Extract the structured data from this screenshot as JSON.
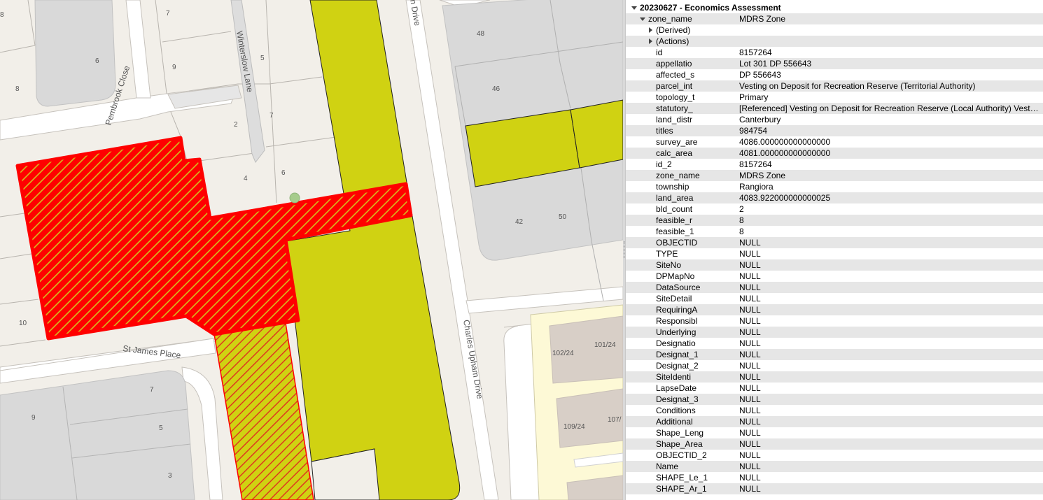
{
  "map": {
    "streets": {
      "pembrook": "Pembrook Close",
      "winterslow": "Winterslow Lane",
      "st_james": "St James Place",
      "charles_upham": "Charles Upham Drive",
      "charles_upham_top": "n Drive"
    },
    "lot_numbers": {
      "n8_top": "8",
      "n7": "7",
      "n5": "5",
      "n9_up": "9",
      "n6_top": "6",
      "n8": "8",
      "n2": "2",
      "n4": "4",
      "n6": "6",
      "n7_lane": "7",
      "n10": "10",
      "n48": "48",
      "n46": "46",
      "n42": "42",
      "n50": "50",
      "n7_low": "7",
      "n9_low": "9",
      "n5_low": "5",
      "n3": "3",
      "b102": "102/24",
      "b101": "101/24",
      "b109": "109/24",
      "b107": "107/"
    },
    "colors": {
      "highlight": "#ff0000",
      "zone": "#d0d212",
      "background": "#f2efe9",
      "parcel": "#d9d9d9"
    }
  },
  "panel": {
    "layer_title": "20230627 - Economics Assessment",
    "feature": {
      "key": "zone_name",
      "value": "MDRS Zone"
    },
    "groups": [
      "(Derived)",
      "(Actions)"
    ],
    "attributes": [
      {
        "key": "id",
        "value": "8157264"
      },
      {
        "key": "appellatio",
        "value": "Lot 301 DP 556643"
      },
      {
        "key": "affected_s",
        "value": "DP 556643"
      },
      {
        "key": "parcel_int",
        "value": "Vesting on Deposit for Recreation Reserve (Territorial Authority)"
      },
      {
        "key": "topology_t",
        "value": "Primary"
      },
      {
        "key": "statutory_",
        "value": "[Referenced] Vesting on Deposit for Recreation Reserve (Local Authority) Vested..."
      },
      {
        "key": "land_distr",
        "value": "Canterbury"
      },
      {
        "key": "titles",
        "value": "984754"
      },
      {
        "key": "survey_are",
        "value": "4086.000000000000000"
      },
      {
        "key": "calc_area",
        "value": "4081.000000000000000"
      },
      {
        "key": "id_2",
        "value": "8157264"
      },
      {
        "key": "zone_name",
        "value": "MDRS Zone"
      },
      {
        "key": "township",
        "value": "Rangiora"
      },
      {
        "key": "land_area",
        "value": "4083.922000000000025"
      },
      {
        "key": "bld_count",
        "value": "2"
      },
      {
        "key": "feasible_r",
        "value": "8"
      },
      {
        "key": "feasible_1",
        "value": "8"
      },
      {
        "key": "OBJECTID",
        "value": "NULL"
      },
      {
        "key": "TYPE",
        "value": "NULL"
      },
      {
        "key": "SiteNo",
        "value": "NULL"
      },
      {
        "key": "DPMapNo",
        "value": "NULL"
      },
      {
        "key": "DataSource",
        "value": "NULL"
      },
      {
        "key": "SiteDetail",
        "value": "NULL"
      },
      {
        "key": "RequiringA",
        "value": "NULL"
      },
      {
        "key": "Responsibl",
        "value": "NULL"
      },
      {
        "key": "Underlying",
        "value": "NULL"
      },
      {
        "key": "Designatio",
        "value": "NULL"
      },
      {
        "key": "Designat_1",
        "value": "NULL"
      },
      {
        "key": "Designat_2",
        "value": "NULL"
      },
      {
        "key": "SiteIdenti",
        "value": "NULL"
      },
      {
        "key": "LapseDate",
        "value": "NULL"
      },
      {
        "key": "Designat_3",
        "value": "NULL"
      },
      {
        "key": "Conditions",
        "value": "NULL"
      },
      {
        "key": "Additional",
        "value": "NULL"
      },
      {
        "key": "Shape_Leng",
        "value": "NULL"
      },
      {
        "key": "Shape_Area",
        "value": "NULL"
      },
      {
        "key": "OBJECTID_2",
        "value": "NULL"
      },
      {
        "key": "Name",
        "value": "NULL"
      },
      {
        "key": "SHAPE_Le_1",
        "value": "NULL"
      },
      {
        "key": "SHAPE_Ar_1",
        "value": "NULL"
      }
    ]
  }
}
